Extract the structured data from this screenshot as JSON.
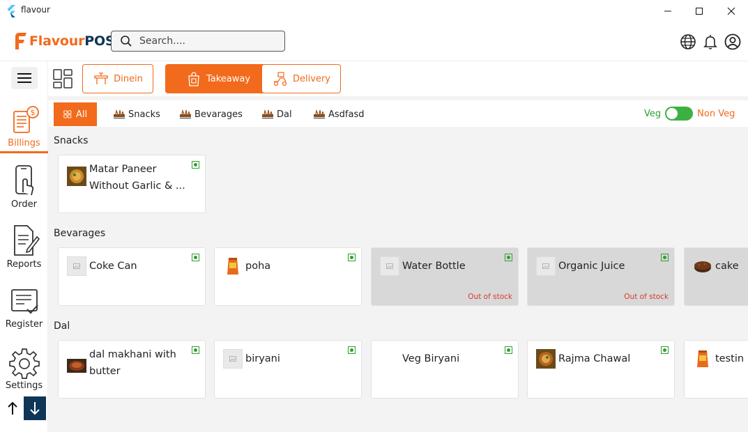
{
  "window": {
    "title": "flavour"
  },
  "header": {
    "logo_first": "Flavour",
    "logo_second": "POS",
    "search_placeholder": "Search....",
    "brand_color": "#f26a1b",
    "navy_color": "#0f3557"
  },
  "sidebar": {
    "items": [
      {
        "label": "Billings",
        "icon": "billing-icon",
        "active": true
      },
      {
        "label": "Order",
        "icon": "phone-order-icon",
        "active": false
      },
      {
        "label": "Reports",
        "icon": "report-icon",
        "active": false
      },
      {
        "label": "Register",
        "icon": "register-icon",
        "active": false
      },
      {
        "label": "Settings",
        "icon": "gear-icon",
        "active": false
      }
    ]
  },
  "order_types": [
    {
      "label": "Dinein",
      "active": false
    },
    {
      "label": "Takeaway",
      "active": true
    },
    {
      "label": "Delivery",
      "active": false
    }
  ],
  "categories": [
    {
      "label": "All",
      "active": true
    },
    {
      "label": "Snacks",
      "active": false
    },
    {
      "label": "Bevarages",
      "active": false
    },
    {
      "label": "Dal",
      "active": false
    },
    {
      "label": "Asdfasd",
      "active": false
    }
  ],
  "veg_toggle": {
    "veg_label": "Veg",
    "nonveg_label": "Non Veg",
    "on": true
  },
  "sections": [
    {
      "title": "Snacks",
      "items": [
        {
          "name_line1": "Matar Paneer",
          "name_line2": "Without Garlic & ...",
          "thumb": "food-photo",
          "veg": true,
          "out_of_stock": false
        }
      ]
    },
    {
      "title": "Bevarages",
      "items": [
        {
          "name_line1": "Coke Can",
          "name_line2": "",
          "thumb": "placeholder",
          "veg": true,
          "out_of_stock": false
        },
        {
          "name_line1": "poha",
          "name_line2": "",
          "thumb": "chips-packet",
          "veg": true,
          "out_of_stock": false
        },
        {
          "name_line1": "Water Bottle",
          "name_line2": "",
          "thumb": "placeholder",
          "veg": true,
          "out_of_stock": true
        },
        {
          "name_line1": "Organic Juice",
          "name_line2": "",
          "thumb": "placeholder",
          "veg": true,
          "out_of_stock": true
        },
        {
          "name_line1": "cake",
          "name_line2": "",
          "thumb": "cake-photo",
          "veg": true,
          "out_of_stock": true
        }
      ]
    },
    {
      "title": "Dal",
      "items": [
        {
          "name_line1": "dal makhani with",
          "name_line2": "butter",
          "thumb": "food-photo",
          "veg": true,
          "out_of_stock": false
        },
        {
          "name_line1": "biryani",
          "name_line2": "",
          "thumb": "placeholder",
          "veg": true,
          "out_of_stock": false
        },
        {
          "name_line1": "Veg Biryani",
          "name_line2": "",
          "thumb": "none",
          "veg": true,
          "out_of_stock": false
        },
        {
          "name_line1": "Rajma Chawal",
          "name_line2": "",
          "thumb": "food-photo",
          "veg": true,
          "out_of_stock": false
        },
        {
          "name_line1": "testin",
          "name_line2": "",
          "thumb": "chips-packet",
          "veg": true,
          "out_of_stock": false
        }
      ]
    }
  ],
  "out_of_stock_label": "Out of stock"
}
